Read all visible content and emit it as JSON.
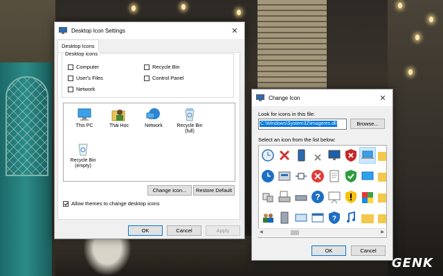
{
  "desktop": {
    "watermark": "GENK"
  },
  "desktop_icon_settings": {
    "title": "Desktop Icon Settings",
    "tab": "Desktop Icons",
    "group_title": "Desktop icons",
    "checkboxes": [
      {
        "label": "Computer",
        "checked": false
      },
      {
        "label": "Recycle Bin",
        "checked": false
      },
      {
        "label": "User's Files",
        "checked": false
      },
      {
        "label": "Control Panel",
        "checked": false
      },
      {
        "label": "Network",
        "checked": false
      }
    ],
    "icons": [
      {
        "label": "This PC",
        "icon": "computer-icon"
      },
      {
        "label": "Thái Học",
        "icon": "user-folder-icon"
      },
      {
        "label": "Network",
        "icon": "network-icon"
      },
      {
        "label": "Recycle Bin\n(full)",
        "icon": "recycle-bin-full-icon"
      },
      {
        "label": "Recycle Bin\n(empty)",
        "icon": "recycle-bin-empty-icon"
      }
    ],
    "change_icon_button": "Change Icon...",
    "restore_default_button": "Restore Default",
    "allow_themes": {
      "label": "Allow themes to change desktop icons",
      "checked": true
    },
    "ok": "OK",
    "cancel": "Cancel",
    "apply": "Apply"
  },
  "change_icon": {
    "title": "Change Icon",
    "look_for_label": "Look for icons in this file:",
    "path_value": "C:\\Windows\\System32\\imageres.dll",
    "browse": "Browse...",
    "select_label": "Select an icon from the list below:",
    "ok": "OK",
    "cancel": "Cancel",
    "accent": "#0078d7"
  }
}
